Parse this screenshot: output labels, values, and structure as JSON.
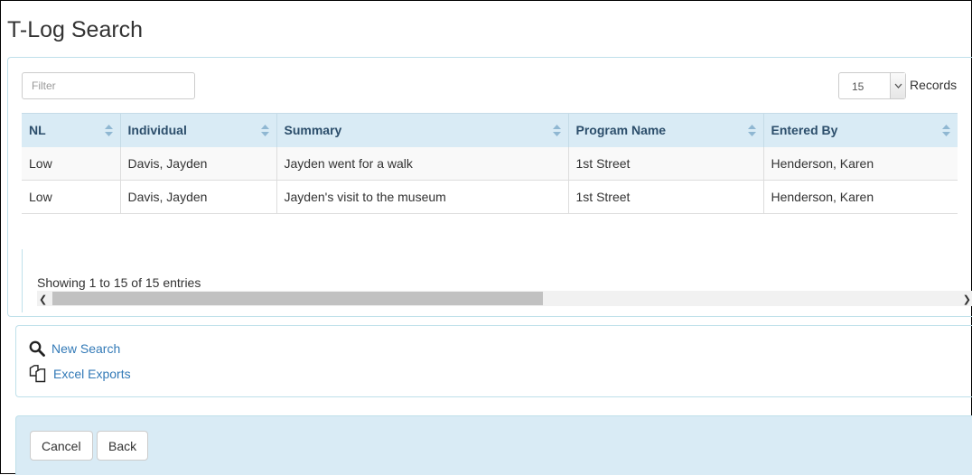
{
  "page": {
    "title": "T-Log Search"
  },
  "filter": {
    "placeholder": "Filter",
    "value": ""
  },
  "records": {
    "selected": "15",
    "label": "Records"
  },
  "table": {
    "columns": [
      "NL",
      "Individual",
      "Summary",
      "Program Name",
      "Entered By"
    ],
    "rows": [
      [
        "Low",
        "Davis, Jayden",
        "Jayden went for a walk",
        "1st Street",
        "Henderson, Karen"
      ],
      [
        "Low",
        "Davis, Jayden",
        "Jayden's visit to the museum",
        "1st Street",
        "Henderson, Karen"
      ]
    ]
  },
  "info": {
    "showing": "Showing 1 to 15 of 15 entries"
  },
  "links": {
    "new_search": "New Search",
    "excel_exports": "Excel Exports"
  },
  "footer": {
    "cancel": "Cancel",
    "back": "Back"
  },
  "icons": {
    "search": "search-icon",
    "export": "copy-icon",
    "sort": "sort-icon",
    "dropdown": "chevron-down-icon"
  },
  "colors": {
    "header_bg": "#d9ebf5",
    "link": "#337ab7",
    "border": "#bfe0ea"
  }
}
